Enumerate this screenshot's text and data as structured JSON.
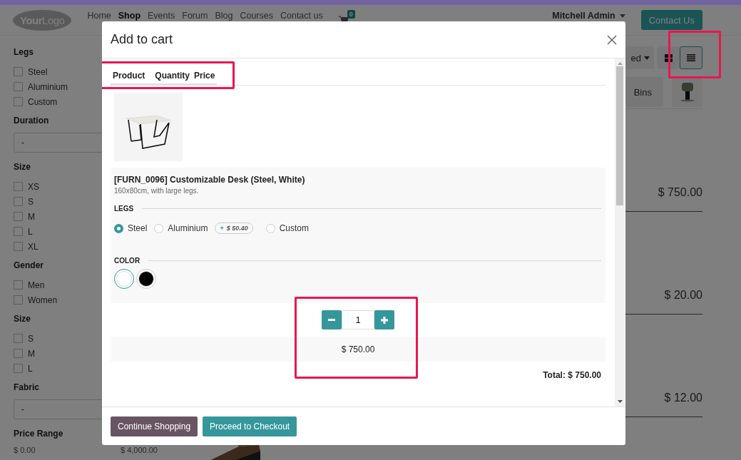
{
  "navbar": {
    "logo": "**Your**Logo",
    "menu": [
      {
        "label": "Home",
        "selected": false
      },
      {
        "label": "Shop",
        "selected": true
      },
      {
        "label": "Events",
        "selected": false
      },
      {
        "label": "Forum",
        "selected": false
      },
      {
        "label": "Blog",
        "selected": false
      },
      {
        "label": "Courses",
        "selected": false
      },
      {
        "label": "Contact us",
        "selected": false
      }
    ],
    "cart_count": "0",
    "user": "Mitchell Admin",
    "cta": "Contact Us"
  },
  "sidebar": {
    "groups": [
      {
        "title": "Legs",
        "kind": "checkboxes",
        "options": [
          {
            "label": "Steel",
            "checked": false
          },
          {
            "label": "Aluminium",
            "checked": false
          },
          {
            "label": "Custom",
            "checked": false
          }
        ]
      },
      {
        "title": "Duration",
        "kind": "select",
        "value": "-"
      },
      {
        "title": "Size",
        "kind": "checkboxes",
        "options": [
          {
            "label": "XS",
            "checked": false
          },
          {
            "label": "S",
            "checked": false
          },
          {
            "label": "M",
            "checked": false
          },
          {
            "label": "L",
            "checked": false
          },
          {
            "label": "XL",
            "checked": false
          }
        ]
      },
      {
        "title": "Gender",
        "kind": "checkboxes",
        "options": [
          {
            "label": "Men",
            "checked": false
          },
          {
            "label": "Women",
            "checked": false
          }
        ]
      },
      {
        "title": "Size",
        "kind": "checkboxes",
        "options": [
          {
            "label": "S",
            "checked": false
          },
          {
            "label": "M",
            "checked": false
          },
          {
            "label": "L",
            "checked": false
          }
        ]
      },
      {
        "title": "Fabric",
        "kind": "select",
        "value": "-"
      },
      {
        "title": "Price Range",
        "kind": "range",
        "min": "$ 0.00",
        "max": "$ 4,000.00"
      }
    ]
  },
  "main": {
    "sort_label": "ed",
    "views": [
      {
        "kind": "grid",
        "selected": false
      },
      {
        "kind": "list",
        "selected": true
      }
    ],
    "categories": [
      {
        "kind": "text",
        "label": "Bins"
      },
      {
        "kind": "picture"
      }
    ],
    "products": [
      {
        "price": "$ 750.00"
      },
      {
        "price": "$ 20.00"
      },
      {
        "price": "$ 12.00"
      }
    ]
  },
  "modal": {
    "title": "Add to cart",
    "columns": [
      "Product",
      "Quantity",
      "Price"
    ],
    "product": {
      "name": "[FURN_0096] Customizable Desk (Steel, White)",
      "description": "160x80cm, with large legs.",
      "attributes": [
        {
          "name": "LEGS",
          "kind": "radio",
          "options": [
            {
              "label": "Steel",
              "selected": true
            },
            {
              "label": "Aluminium",
              "selected": false,
              "extra": {
                "sign": "+",
                "amount": "$ 50.40"
              }
            },
            {
              "label": "Custom",
              "selected": false
            }
          ]
        },
        {
          "name": "COLOR",
          "kind": "swatches",
          "options": [
            {
              "color": "#ffffff",
              "selected": true
            },
            {
              "color": "#000000",
              "selected": false
            }
          ]
        }
      ]
    },
    "quantity": "1",
    "price": "$ 750.00",
    "total": "Total: $ 750.00",
    "buttons": [
      {
        "label": "Continue Shopping",
        "kind": "secondary"
      },
      {
        "label": "Proceed to Checkout",
        "kind": "primary"
      }
    ]
  }
}
